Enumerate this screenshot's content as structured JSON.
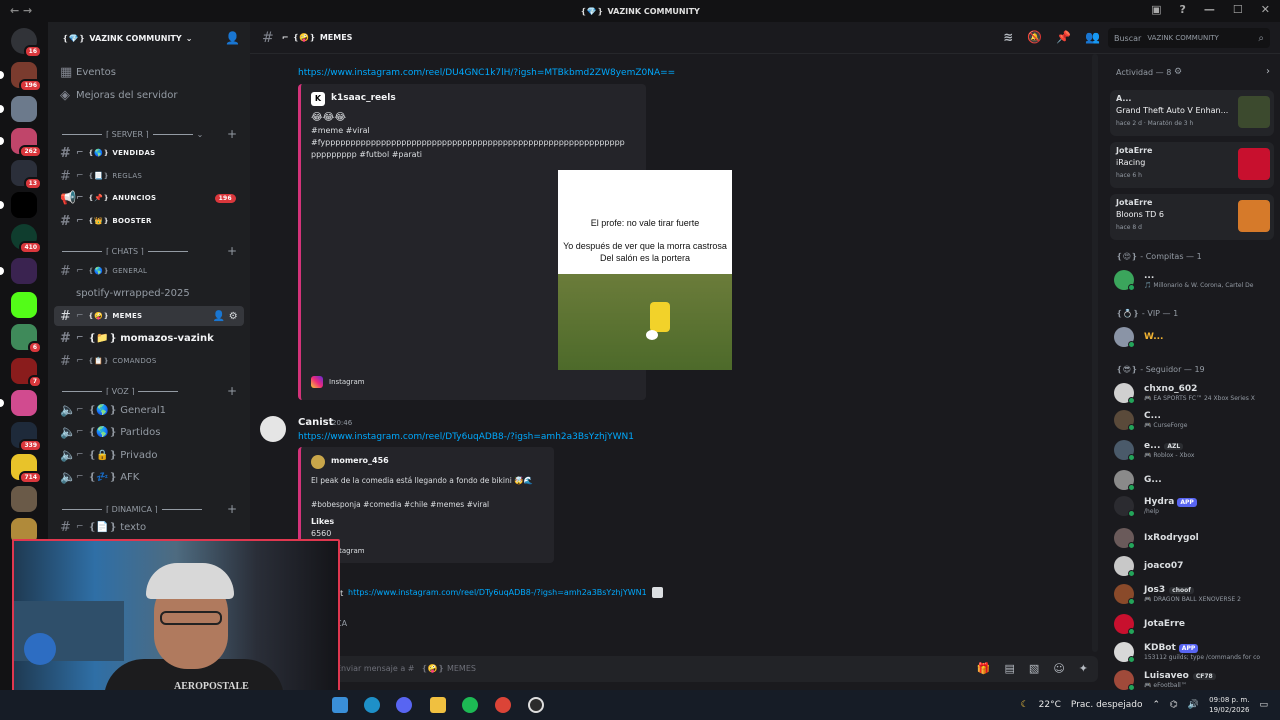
{
  "window": {
    "title": "VAZINK COMMUNITY",
    "title_prefix": "❴💎❵"
  },
  "server": {
    "name": "VAZINK COMMUNITY",
    "name_prefix": "❴💎❵",
    "badges": [
      "16",
      "196",
      "262",
      "13",
      "410",
      "6",
      "7",
      "339",
      "714"
    ]
  },
  "sidebar": {
    "top_items": [
      {
        "label": "Eventos",
        "icon": "calendar-icon"
      },
      {
        "label": "Mejoras del servidor",
        "icon": "boost-icon"
      }
    ],
    "categories": {
      "server": "⌈ SERVER ⌉",
      "chats": "⌈ CHATS ⌉",
      "voz": "⌈ VOZ ⌉",
      "dinamica": "⌈ DINAMICA ⌉"
    },
    "channels": [
      {
        "label": "VENDIDAS",
        "prefix": "❴🌎❵",
        "bold": true,
        "small": true
      },
      {
        "label": "REGLAS",
        "prefix": "❴📃❵",
        "small": true
      },
      {
        "label": "ANUNCIOS",
        "prefix": "❴📌❵",
        "bold": true,
        "small": true,
        "badge": "196"
      },
      {
        "label": "BOOSTER",
        "prefix": "❴👑❵",
        "bold": true,
        "small": true
      },
      {
        "label": "GENERAL",
        "prefix": "❴🌎❵",
        "small": true
      },
      {
        "label": "spotify-wrrapped-2025"
      },
      {
        "label": "MEMES",
        "prefix": "❴🤪❵",
        "active": true,
        "small": true
      },
      {
        "label": "momazos-vazink",
        "prefix": "❴📁❵",
        "bold": true
      },
      {
        "label": "COMANDOS",
        "prefix": "❴📋❵",
        "small": true
      },
      {
        "label": "General1",
        "prefix": "❴🌎❵"
      },
      {
        "label": "Partidos",
        "prefix": "❴🌎❵"
      },
      {
        "label": "Privado",
        "prefix": "❴🔒❵"
      },
      {
        "label": "AFK",
        "prefix": "❴💤❵"
      },
      {
        "label": "texto",
        "prefix": "❴📄❵"
      }
    ]
  },
  "header": {
    "channel": "MEMES",
    "channel_prefix": "❴🤪❵",
    "search_placeholder": "Buscar",
    "search_server": "VAZINK COMMUNITY"
  },
  "messages": {
    "m1": {
      "link": "https://www.instagram.com/reel/DU4GNC1k7lH/?igsh=MTBkbmd2ZW8yemZ0NA==",
      "embed_author": "k1saac_reels",
      "embed_emojis": "😂😂😂",
      "embed_text1": "#meme #viral",
      "embed_text2": "#fyppppppppppppppppppppppppppppppppppppppppppppppppppppppppppp",
      "embed_text3": "ppppppppp #futbol #parati",
      "image_line1": "El profe: no vale tirar fuerte",
      "image_line2": "Yo después de ver que la morra castrosa  Del salón  es la portera",
      "footer": "Instagram"
    },
    "m2": {
      "author": "Canist",
      "time": "20:46",
      "link": "https://www.instagram.com/reel/DTy6uqADB8-/?igsh=amh2a3BsYzhjYWN1",
      "embed_author": "momero_456",
      "embed_text1": "El peak de la comedia está llegando a fondo de bikini 🤯🌊",
      "embed_text2": "#bobesponja #comedia #chile #memes #viral",
      "likes_label": "Likes",
      "likes_value": "6560",
      "footer": "Instagram"
    },
    "m3": {
      "link": "https://www.instagram.com/reel/DTy6uqADB8-/?igsh=amh2a3BsYzhjYWN1",
      "author_partial": "st",
      "reply_partial": "CA"
    }
  },
  "composer": {
    "placeholder": "Enviar mensaje a #",
    "channel": "❴🤪❵ MEMES"
  },
  "members": {
    "activity_title": "Actividad — 8",
    "activities": [
      {
        "who": "A...",
        "game": "Grand Theft Auto V Enhan...",
        "when": "hace 2 d",
        "extra": "Maratón de 3 h",
        "color": "#3c4a2e"
      },
      {
        "who": "JotaErre",
        "game": "iRacing",
        "when": "hace 6 h",
        "color": "#c8102e"
      },
      {
        "who": "JotaErre",
        "game": "Bloons TD 6",
        "when": "hace 8 d",
        "color": "#d67a2a"
      }
    ],
    "groups": [
      {
        "title": "❴😍❵ - Compitas — 1"
      },
      {
        "title": "❴💍❵ - VIP — 1"
      },
      {
        "title": "❴😎❵ - Seguidor — 19"
      }
    ],
    "compitas": [
      {
        "name": "...",
        "sub": "🎵 Millonario & W. Corona, Cartel De"
      }
    ],
    "vip": [
      {
        "name": "W...",
        "sub": ""
      }
    ],
    "seguidores": [
      {
        "name": "chxno_602",
        "sub": "🎮 EA SPORTS FC™ 24 Xbox Series X"
      },
      {
        "name": "C...",
        "sub": "🎮 CurseForge"
      },
      {
        "name": "e...",
        "tag": "AZL",
        "sub": "🎮 Roblox - Xbox"
      },
      {
        "name": "G...",
        "sub": ""
      },
      {
        "name": "Hydra",
        "tag": "APP",
        "sub": "/help"
      },
      {
        "name": "IxRodrygol",
        "sub": ""
      },
      {
        "name": "joaco07",
        "sub": ""
      },
      {
        "name": "Jos3",
        "tag": "choof",
        "sub": "🎮 DRAGON BALL XENOVERSE 2"
      },
      {
        "name": "JotaErre",
        "sub": ""
      },
      {
        "name": "KDBot",
        "tag": "APP",
        "sub": "153112 guilds; type /commands for co"
      },
      {
        "name": "Luisaveo",
        "tag": "CF78",
        "sub": "🎮 eFootball™"
      }
    ]
  },
  "taskbar": {
    "weather_temp": "22°C",
    "weather_desc": "Prac. despejado",
    "time": "09:08 p. m.",
    "date": "19/02/2026"
  },
  "webcam": {
    "shirt_text": "AEROPOSTALE"
  },
  "colors": {
    "accent": "#5865f2",
    "link": "#00a8fc",
    "badge": "#da373c",
    "embed_border": "#d4337a",
    "online": "#23a55a"
  }
}
